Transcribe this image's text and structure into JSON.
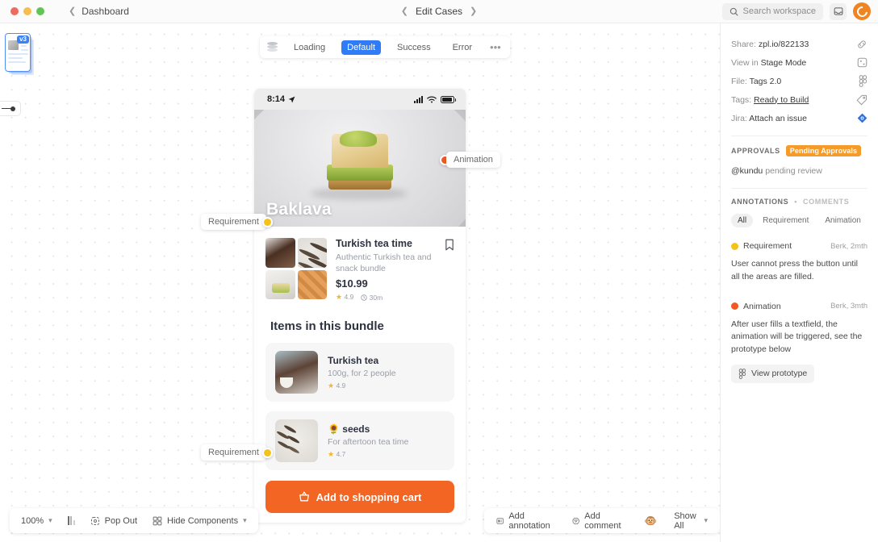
{
  "titlebar": {
    "back_label": "Dashboard",
    "center_label": "Edit Cases",
    "search_placeholder": "Search workspace",
    "inbox_icon": "inbox-icon",
    "avatar_icon": "user-avatar"
  },
  "variant_bar": {
    "layers_icon": "layers-icon",
    "items": [
      {
        "label": "Loading",
        "active": false
      },
      {
        "label": "Default",
        "active": true
      },
      {
        "label": "Success",
        "active": false
      },
      {
        "label": "Error",
        "active": false
      }
    ],
    "more_label": "•••"
  },
  "version_rail": {
    "badge": "v3",
    "handle_icon": "slider-handle-icon"
  },
  "phone": {
    "status": {
      "time": "8:14",
      "location_icon": "location-arrow-icon",
      "signal_icon": "cellular-icon",
      "wifi_icon": "wifi-icon",
      "battery_icon": "battery-icon"
    },
    "hero_title": "Baklava",
    "product": {
      "title": "Turkish tea time",
      "description": "Authentic Turkish tea and snack bundle",
      "price": "$10.99",
      "rating": "4.9",
      "time": "30m",
      "bookmark_icon": "bookmark-icon"
    },
    "bundle_heading": "Items in this bundle",
    "items": [
      {
        "title": "Turkish tea",
        "description": "100g, for 2 people",
        "rating": "4.9"
      },
      {
        "title": "🌻 seeds",
        "description": "For aftertoon tea time",
        "rating": "4.7"
      }
    ],
    "cart_button": {
      "label": "Add to shopping cart",
      "icon": "basket-icon"
    }
  },
  "pins": [
    {
      "label": "Animation",
      "color": "#f05a22"
    },
    {
      "label": "Requirement",
      "color": "#f5c218"
    },
    {
      "label": "Requirement",
      "color": "#f5c218"
    }
  ],
  "bottom_left": {
    "zoom": "100%",
    "zoom_caret": "▾",
    "compare_icon": "compare-icon",
    "popout": {
      "label": "Pop Out",
      "icon": "pop-out-icon"
    },
    "hide_components": {
      "label": "Hide Components",
      "icon": "components-icon",
      "caret": "▾"
    }
  },
  "bottom_right": {
    "add_annotation": {
      "label": "Add annotation",
      "icon": "annotation-icon"
    },
    "add_comment": {
      "label": "Add comment",
      "icon": "comment-icon"
    },
    "emoji": "🐵",
    "show_all": {
      "label": "Show All",
      "caret": "▾"
    }
  },
  "panel": {
    "meta": [
      {
        "key": "Share:",
        "value": "zpl.io/822133",
        "icon": "link-icon",
        "underline": false
      },
      {
        "key": "View in",
        "value": "Stage Mode",
        "icon": "stage-mode-icon",
        "underline": false
      },
      {
        "key": "File:",
        "value": "Tags 2.0",
        "icon": "figma-icon",
        "underline": false
      },
      {
        "key": "Tags:",
        "value": "Ready to Build",
        "icon": "tag-icon",
        "underline": true
      },
      {
        "key": "Jira:",
        "value": "Attach an issue",
        "icon": "jira-icon",
        "underline": false
      }
    ],
    "approvals": {
      "heading": "APPROVALS",
      "badge": "Pending Approvals",
      "status_user": "@kundu",
      "status_text": "pending review"
    },
    "annotations": {
      "heading": "ANNOTATIONS",
      "separator": "•",
      "heading_alt": "COMMENTS",
      "filters": [
        {
          "label": "All",
          "active": true
        },
        {
          "label": "Requirement",
          "active": false
        },
        {
          "label": "Animation",
          "active": false
        }
      ],
      "entries": [
        {
          "type": "Requirement",
          "color": "#f5c218",
          "author": "Berk, 2mth",
          "body": "User cannot press the button until all the areas are filled."
        },
        {
          "type": "Animation",
          "color": "#f05a22",
          "author": "Berk, 3mth",
          "body": "After user fills a textfield, the animation will be triggered, see the prototype below",
          "action": {
            "label": "View prototype",
            "icon": "figma-icon"
          }
        }
      ]
    }
  }
}
